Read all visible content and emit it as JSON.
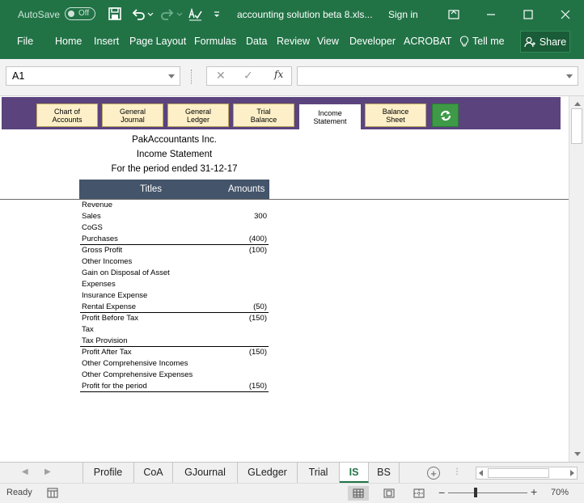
{
  "titlebar": {
    "autosave_label": "AutoSave",
    "autosave_state": "Off",
    "doc_title": "accounting solution beta 8.xls...",
    "sign_in": "Sign in"
  },
  "ribbon": {
    "tabs": [
      "File",
      "Home",
      "Insert",
      "Page Layout",
      "Formulas",
      "Data",
      "Review",
      "View",
      "Developer",
      "ACROBAT"
    ],
    "tell_me": "Tell me",
    "share": "Share"
  },
  "formula_bar": {
    "name_box": "A1",
    "fx_label": "fx",
    "formula": ""
  },
  "nav_buttons": [
    {
      "line1": "Chart of",
      "line2": "Accounts"
    },
    {
      "line1": "General",
      "line2": "Journal"
    },
    {
      "line1": "General",
      "line2": "Ledger"
    },
    {
      "line1": "Trial",
      "line2": "Balance"
    },
    {
      "line1": "Income",
      "line2": "Statement"
    },
    {
      "line1": "Balance",
      "line2": "Sheet"
    }
  ],
  "report": {
    "company": "PakAccountants Inc.",
    "title": "Income Statement",
    "period": "For the period ended 31-12-17",
    "col_titles": "Titles",
    "col_amounts": "Amounts",
    "rows": [
      {
        "label": "Revenue",
        "amount": ""
      },
      {
        "label": "Sales",
        "amount": "300"
      },
      {
        "label": "CoGS",
        "amount": ""
      },
      {
        "label": "Purchases",
        "amount": "(400)"
      },
      {
        "label": "Gross Profit",
        "amount": "(100)"
      },
      {
        "label": "Other Incomes",
        "amount": ""
      },
      {
        "label": "Gain on Disposal of Asset",
        "amount": ""
      },
      {
        "label": "Expenses",
        "amount": ""
      },
      {
        "label": "Insurance Expense",
        "amount": ""
      },
      {
        "label": "Rental Expense",
        "amount": "(50)"
      },
      {
        "label": "Profit Before Tax",
        "amount": "(150)"
      },
      {
        "label": "Tax",
        "amount": ""
      },
      {
        "label": "Tax Provision",
        "amount": ""
      },
      {
        "label": "Profit After Tax",
        "amount": "(150)"
      },
      {
        "label": "Other Comprehensive Incomes",
        "amount": ""
      },
      {
        "label": "Other Comprehensive Expenses",
        "amount": ""
      },
      {
        "label": "Profit for the period",
        "amount": "(150)"
      }
    ]
  },
  "sheet_tabs": [
    "Profile",
    "CoA",
    "GJournal",
    "GLedger",
    "Trial",
    "IS",
    "BS"
  ],
  "active_sheet": "IS",
  "status": {
    "ready": "Ready",
    "zoom": "70%"
  },
  "colors": {
    "excel_green": "#217346",
    "nav_band": "#5b447e",
    "nav_button": "#fdf0c8",
    "table_header": "#44546a"
  }
}
